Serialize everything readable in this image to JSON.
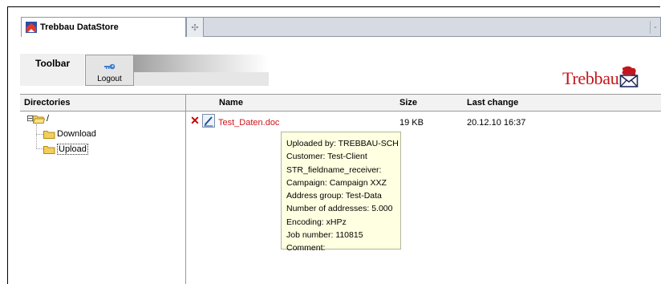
{
  "browser": {
    "tab_title": "Trebbau DataStore",
    "new_tab_glyph": "✣",
    "strip_end_glyph": "-"
  },
  "toolbar": {
    "title": "Toolbar",
    "logout_label": "Logout",
    "logout_icon": "key-icon"
  },
  "logo": {
    "text": "Trebbau",
    "icon": "envelope-icon",
    "color": "#c5151c"
  },
  "directories": {
    "header": "Directories",
    "root": {
      "label": "/",
      "expander": "⊟"
    },
    "children": [
      {
        "label": "Download",
        "selected": false
      },
      {
        "label": "Upload",
        "selected": true
      }
    ]
  },
  "files": {
    "columns": {
      "name": "Name",
      "size": "Size",
      "last_change": "Last change"
    },
    "rows": [
      {
        "name": "Test_Daten.doc",
        "size": "19 KB",
        "last_change": "20.12.10 16:37"
      }
    ]
  },
  "tooltip": {
    "lines": [
      "Uploaded by: TREBBAU-SCH",
      "Customer: Test-Client",
      "STR_fieldname_receiver:",
      "Campaign: Campaign XXZ",
      "Address group: Test-Data",
      "Number of addresses: 5.000",
      "Encoding: xHPz",
      "Job number: 110815",
      "Comment:"
    ]
  },
  "colors": {
    "link_red": "#d0141b",
    "tooltip_bg": "#ffffe1"
  }
}
